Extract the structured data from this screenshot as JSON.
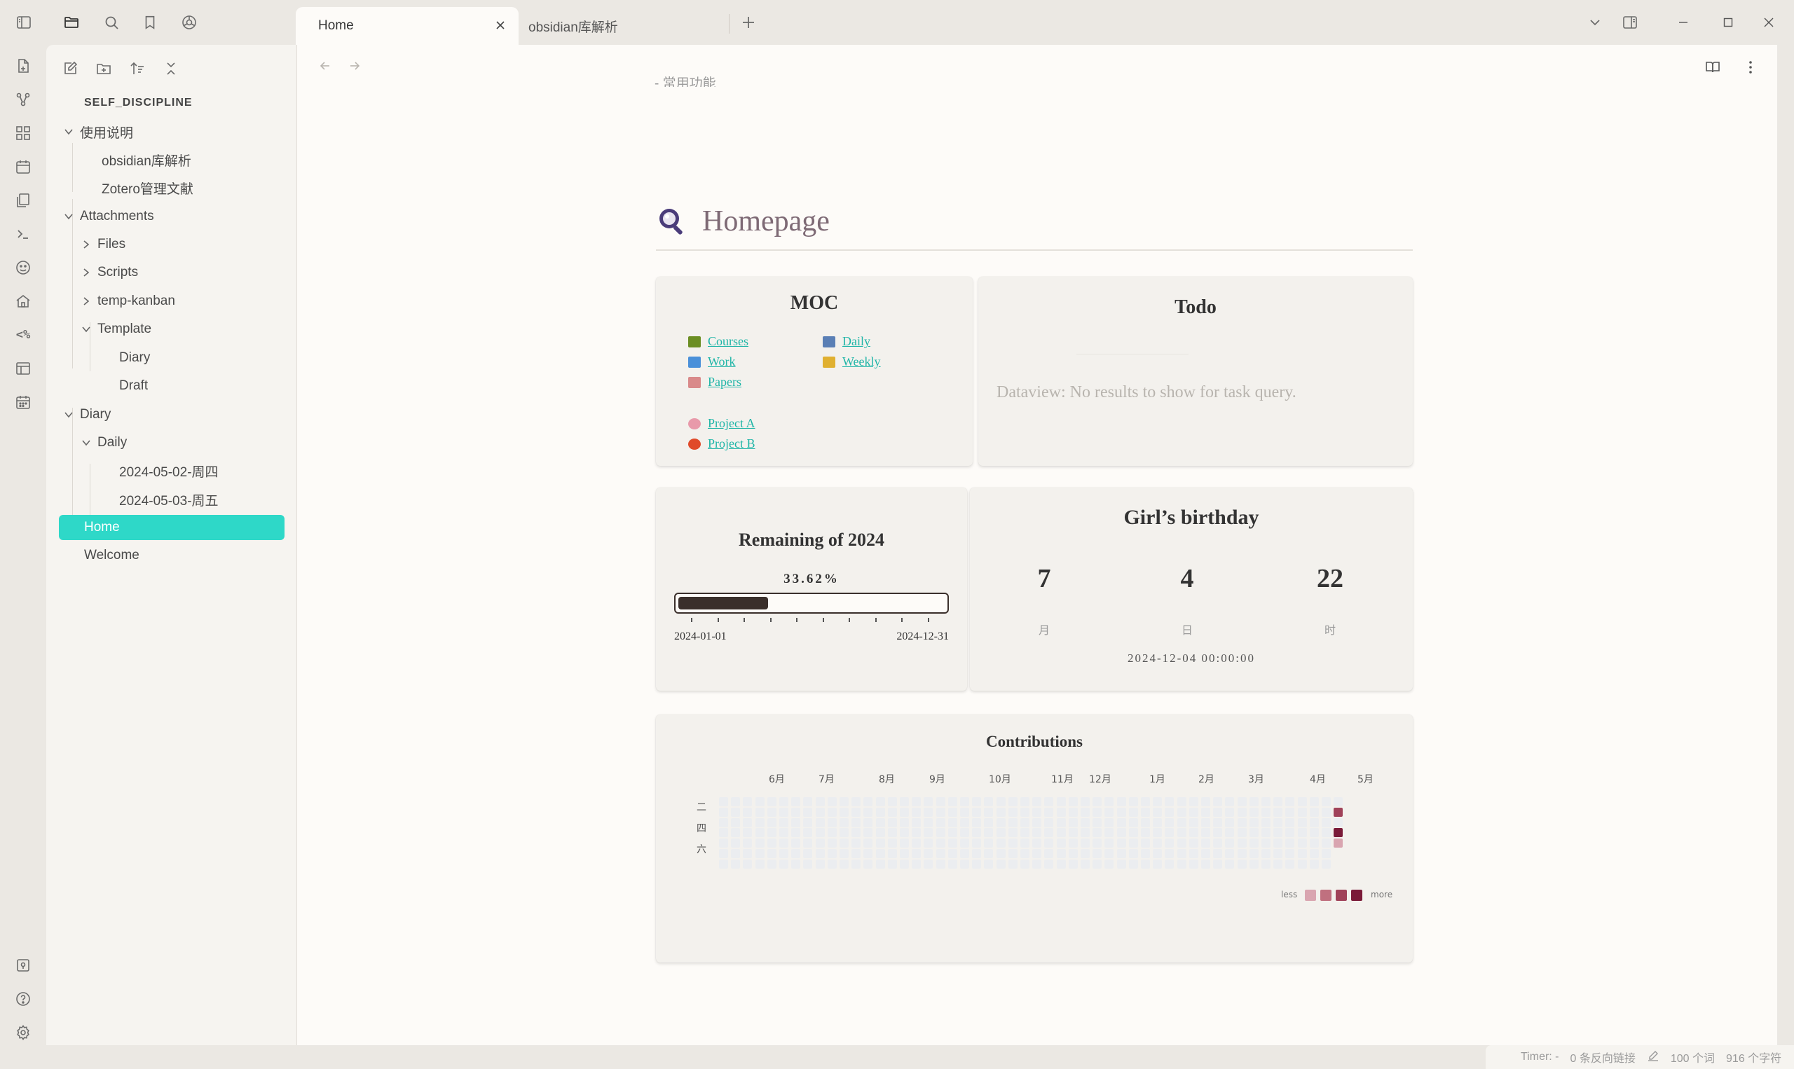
{
  "tabs": [
    {
      "label": "Home",
      "active": true
    },
    {
      "label": "obsidian库解析",
      "active": false
    }
  ],
  "titlebar_icons": [
    "sidebar-toggle-icon",
    "folder-icon",
    "search-icon",
    "bookmark-icon",
    "graph-icon",
    "new-tab-icon",
    "tab-list-icon",
    "right-sidebar-icon",
    "minimize-icon",
    "maximize-icon",
    "close-window-icon"
  ],
  "ribbon": {
    "icons": [
      "open-file-icon",
      "graph-view-icon",
      "canvas-icon",
      "daily-note-icon",
      "templates-icon",
      "terminal-icon",
      "mood-icon",
      "home-icon",
      "templater-icon",
      "layout-icon",
      "calendar-icon"
    ],
    "templater_label": "<%",
    "bottom_icons": [
      "vault-switch-icon",
      "help-icon",
      "settings-icon"
    ]
  },
  "sidebar": {
    "vault_name": "SELF_DISCIPLINE",
    "tree": [
      {
        "label": "使用说明",
        "type": "folder",
        "expanded": true,
        "depth": 0
      },
      {
        "label": "obsidian库解析",
        "type": "file",
        "depth": 1
      },
      {
        "label": "Zotero管理文献",
        "type": "file",
        "depth": 1
      },
      {
        "label": "Attachments",
        "type": "folder",
        "expanded": true,
        "depth": 0
      },
      {
        "label": "Files",
        "type": "folder",
        "expanded": false,
        "depth": 1
      },
      {
        "label": "Scripts",
        "type": "folder",
        "expanded": false,
        "depth": 1
      },
      {
        "label": "temp-kanban",
        "type": "folder",
        "expanded": false,
        "depth": 1
      },
      {
        "label": "Template",
        "type": "folder",
        "expanded": true,
        "depth": 1
      },
      {
        "label": "Diary",
        "type": "file",
        "depth": 2
      },
      {
        "label": "Draft",
        "type": "file",
        "depth": 2
      },
      {
        "label": "Diary",
        "type": "folder",
        "expanded": true,
        "depth": 0
      },
      {
        "label": "Daily",
        "type": "folder",
        "expanded": true,
        "depth": 1
      },
      {
        "label": "2024-05-02-周四",
        "type": "file",
        "depth": 2
      },
      {
        "label": "2024-05-03-周五",
        "type": "file",
        "depth": 2
      },
      {
        "label": "Home",
        "type": "file",
        "depth": 0,
        "active": true
      },
      {
        "label": "Welcome",
        "type": "file",
        "depth": 0
      }
    ]
  },
  "page": {
    "scroll_ghost_text": "- 常用功能",
    "title": "Homepage",
    "moc": {
      "title": "MOC",
      "links_col1": [
        {
          "label": "Courses",
          "color": "#6b8e23"
        },
        {
          "label": "Work",
          "color": "#4a90d9"
        },
        {
          "label": "Papers",
          "color": "#d98a8a"
        }
      ],
      "links_col2": [
        {
          "label": "Daily",
          "color": "#5a7fb5"
        },
        {
          "label": "Weekly",
          "color": "#e0b030"
        }
      ],
      "projects": [
        {
          "label": "Project A",
          "color": "#e89aaa"
        },
        {
          "label": "Project B",
          "color": "#e04a2a"
        }
      ]
    },
    "todo": {
      "title": "Todo",
      "message": "Dataview: No results to show for task query."
    },
    "remaining": {
      "title": "Remaining of 2024",
      "percent_text": "33.62%",
      "fraction": 0.3362,
      "start": "2024-01-01",
      "end": "2024-12-31"
    },
    "birthday": {
      "title": "Girl’s birthday",
      "months": "7",
      "days": "4",
      "hours": "22",
      "months_unit": "月",
      "days_unit": "日",
      "hours_unit": "时",
      "target": "2024-12-04 00:00:00"
    },
    "contributions": {
      "title": "Contributions",
      "months": [
        "6月",
        "7月",
        "8月",
        "9月",
        "10月",
        "11月",
        "12月",
        "1月",
        "2月",
        "3月",
        "4月",
        "5月"
      ],
      "weekdays": [
        "二",
        "四",
        "六"
      ],
      "active_cells": [
        {
          "week": 51,
          "day": 1,
          "level": 3
        },
        {
          "week": 51,
          "day": 3,
          "level": 4
        },
        {
          "week": 51,
          "day": 4,
          "level": 1
        }
      ],
      "legend_less": "less",
      "legend_more": "more",
      "level_colors": [
        "#ebedf0",
        "#d9a5b0",
        "#c0707f",
        "#a04259",
        "#7a1a38"
      ]
    }
  },
  "statusbar": {
    "timer": "Timer: -",
    "backlinks": "0 条反向链接",
    "words": "100 个词",
    "chars": "916 个字符"
  }
}
